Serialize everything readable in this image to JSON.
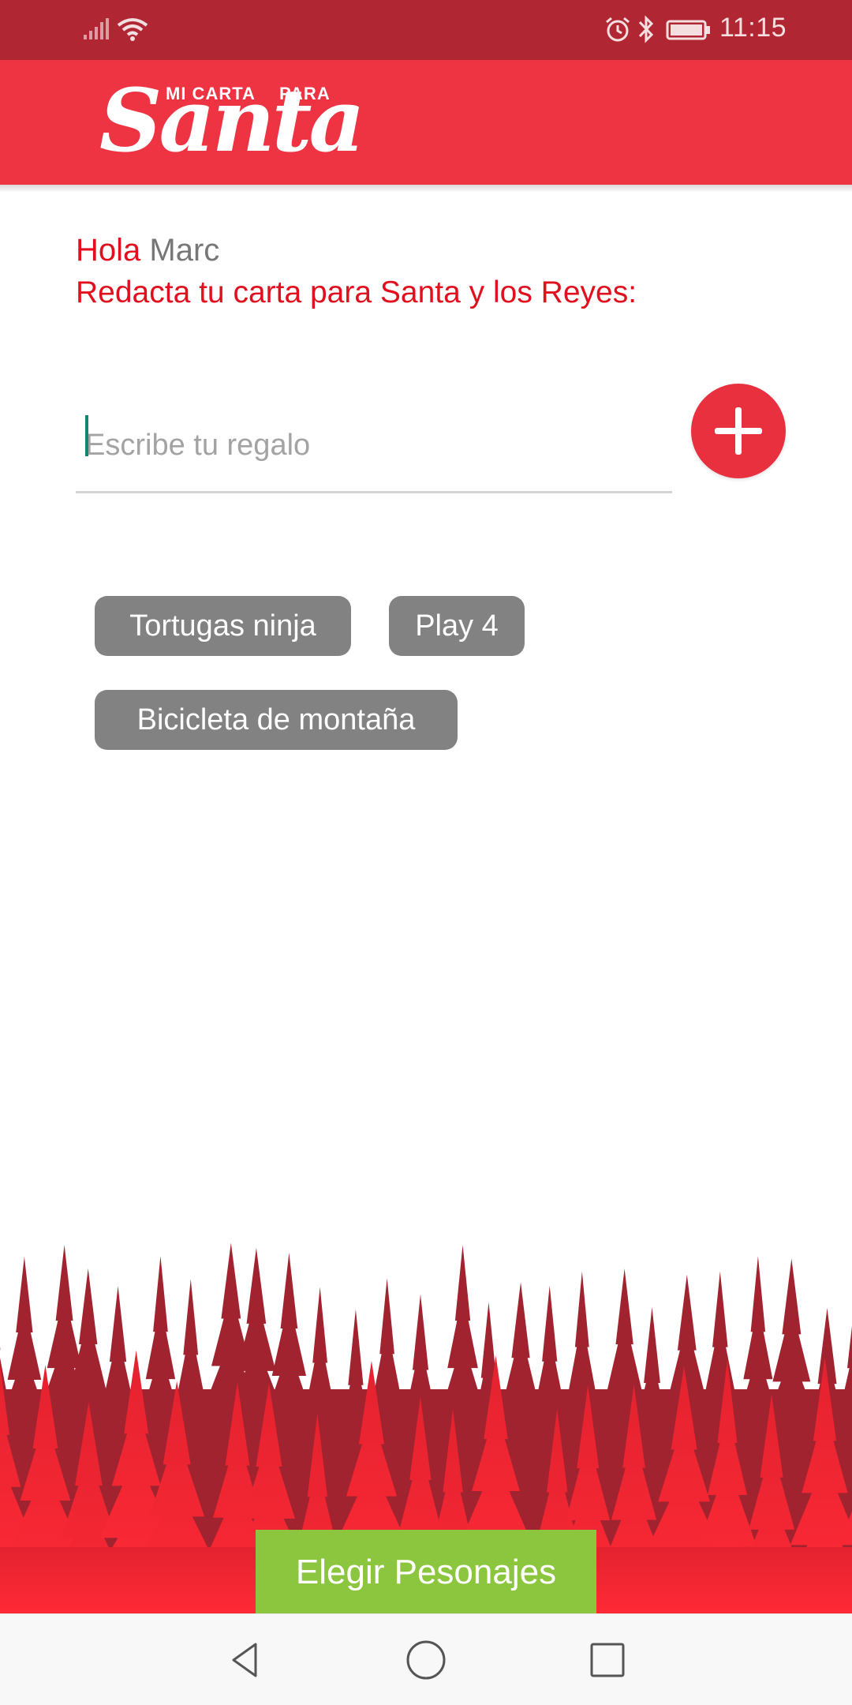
{
  "status_bar": {
    "time": "11:15",
    "icons": [
      "signal-icon",
      "wifi-icon",
      "alarm-icon",
      "bluetooth-icon",
      "battery-icon"
    ]
  },
  "app_bar": {
    "logo_top_left": "MI CARTA",
    "logo_top_right": "PARA",
    "logo_script": "Santa",
    "background_color": "#ee3342"
  },
  "greeting": {
    "hola": "Hola",
    "name": "Marc",
    "subtitle": "Redacta tu carta para Santa y los Reyes:"
  },
  "gift_input": {
    "value": "",
    "placeholder": "Escribe tu regalo"
  },
  "add_button": {
    "icon": "plus-icon",
    "color": "#e8303f"
  },
  "gifts": [
    {
      "label": "Tortugas ninja"
    },
    {
      "label": "Play 4"
    },
    {
      "label": "Bicicleta de montaña"
    }
  ],
  "choose_button": {
    "label": "Elegir Pesonajes",
    "color": "#8cc63f"
  },
  "nav_bar": {
    "icons": [
      "back-icon",
      "home-icon",
      "recent-apps-icon"
    ]
  }
}
